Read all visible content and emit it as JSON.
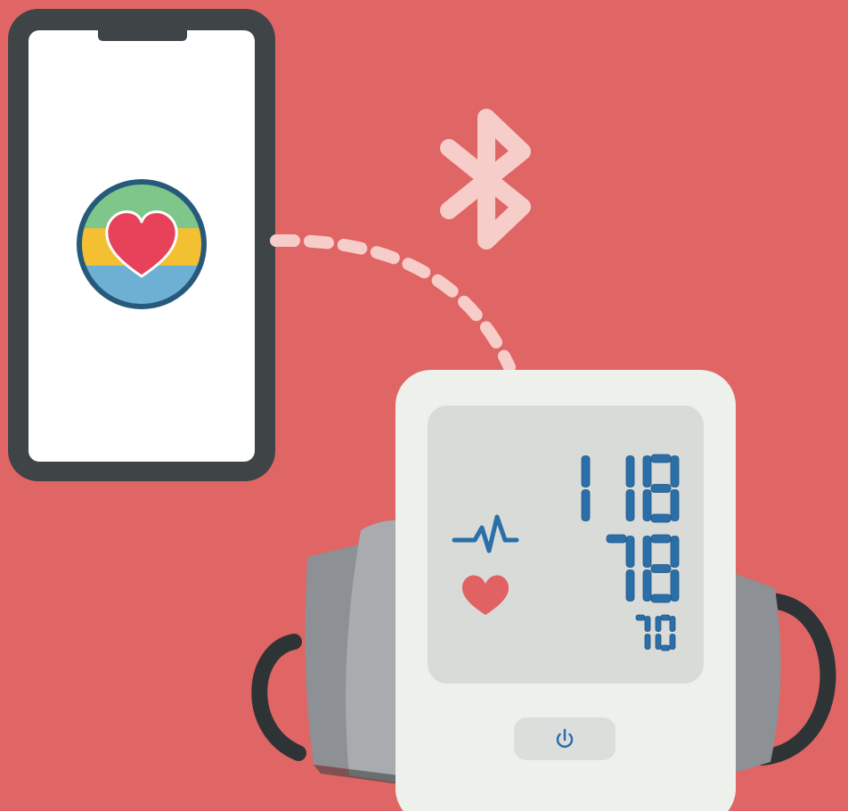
{
  "colors": {
    "background": "#e06565",
    "phone_frame": "#3f4447",
    "phone_screen": "#ffffff",
    "app_icon_green": "#7ec68a",
    "app_icon_yellow": "#f3c034",
    "app_icon_blue": "#6db0d3",
    "app_icon_ring": "#26597a",
    "heart": "#e8415a",
    "bluetooth": "#f7cdc9",
    "dash_line": "#f7cdc9",
    "monitor_body": "#eef0ec",
    "monitor_display": "#d9dbd8",
    "lcd_digits": "#2b6fa8",
    "lcd_heart": "#e06262",
    "cuff_dark": "#8d9094",
    "cuff_light": "#a9acaf",
    "tube": "#2e3436",
    "power_button": "#dcdedc",
    "power_icon": "#2b6fa8"
  },
  "phone": {
    "app_icon": "heart-app-icon"
  },
  "connection": {
    "icon": "bluetooth-icon"
  },
  "monitor": {
    "systolic": "118",
    "diastolic": "78",
    "pulse": "70",
    "pulse_icon": "heartbeat-line-icon",
    "heart_icon": "heart-icon",
    "power_icon": "power-icon"
  }
}
